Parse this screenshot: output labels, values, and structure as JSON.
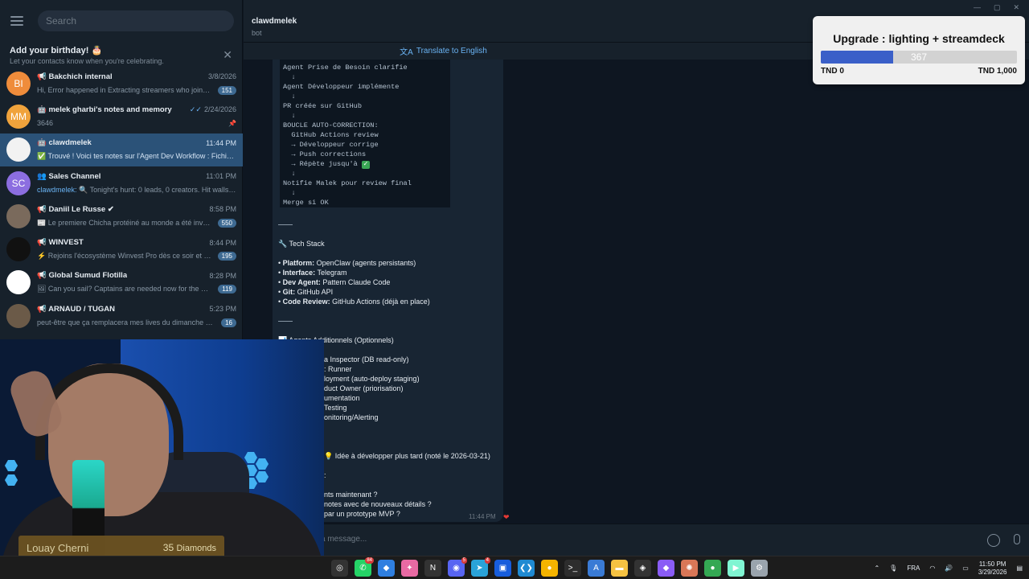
{
  "sidebar": {
    "search_placeholder": "Search",
    "birthday_title": "Add your birthday! 🎂",
    "birthday_sub": "Let your contacts know when you're celebrating.",
    "chats": [
      {
        "initials": "BI",
        "color": "#ef8c3b",
        "name": "📢 Bakchich internal",
        "time": "3/8/2026",
        "preview": "Hi, Error happened in Extracting streamers who joined ...",
        "badge": "151"
      },
      {
        "initials": "MM",
        "color": "#f0a33c",
        "name": "🤖 melek gharbi's notes and memory",
        "time": "2/24/2026",
        "ticks": "✓✓",
        "preview": "3646",
        "pin": "📌"
      },
      {
        "initials": "",
        "color": "#f2f2f2",
        "name": "🤖 clawdmelek",
        "time": "11:44 PM",
        "preview": "✅ Trouvé ! Voici tes notes sur l'Agent Dev Workflow : Fichier...",
        "active": true
      },
      {
        "initials": "SC",
        "color": "#8c6ee0",
        "name": "👥 Sales Channel",
        "time": "11:01 PM",
        "sender": "clawdmelek:",
        "preview": " 🔍 Tonight's hunt: 0 leads, 0 creators. Hit walls ..."
      },
      {
        "initials": "",
        "color": "#7a6a5c",
        "name": "📢 Daniil Le Russe ✔",
        "time": "8:58 PM",
        "preview": "📰 Le premiere Chicha protéiné au monde a été invent...",
        "badge": "550"
      },
      {
        "initials": "",
        "color": "#111111",
        "name": "📢 WINVEST",
        "time": "8:44 PM",
        "preview": "⚡ Rejoins l'écosystème Winvest Pro dès ce soir et sois...",
        "badge": "195"
      },
      {
        "initials": "",
        "color": "#ffffff",
        "name": "📢 Global Sumud Flotilla",
        "time": "8:28 PM",
        "preview": "🖼 Can you sail?  Captains are needed now for the Glo...",
        "badge": "119"
      },
      {
        "initials": "",
        "color": "#6b5a48",
        "name": "📢 ARNAUD / TUGAN",
        "time": "5:23 PM",
        "preview": "peut-être que ça remplacera mes lives du dimanche que ...",
        "badge": "16"
      }
    ]
  },
  "header": {
    "title": "clawdmelek",
    "subtitle": "bot",
    "translate": "Translate to English"
  },
  "message": {
    "code_lines": [
      "Agent Prise de Besoin clarifie",
      "  ↓",
      "Agent Développeur implémente",
      "  ↓",
      "PR créée sur GitHub",
      "  ↓",
      "BOUCLE AUTO-CORRECTION:",
      "  GitHub Actions review",
      "  → Développeur corrige",
      "  → Push corrections",
      "  → Répète jusqu'à ",
      "  ↓",
      "Notifie Malek pour review final",
      "  ↓",
      "Merge si OK"
    ],
    "tech_stack_title": "🔧 Tech Stack",
    "tech_stack": [
      {
        "label": "Platform:",
        "value": " OpenClaw (agents persistants)"
      },
      {
        "label": "Interface:",
        "value": " Telegram"
      },
      {
        "label": "Dev Agent:",
        "value": " Pattern Claude Code"
      },
      {
        "label": "Git:",
        "value": " GitHub API"
      },
      {
        "label": "Code Review:",
        "value": " GitHub Actions (déjà en place)"
      }
    ],
    "optional_title": "📊 Agents Additionnels (Optionnels)",
    "optional_items": [
      "a Inspector (DB read-only)",
      ": Runner",
      "loyment (auto-deploy staging)",
      "duct Owner (priorisation)",
      "umentation",
      "Testing",
      "onitoring/Alerting"
    ],
    "idea_line": "💡 Idée à développer plus tard (noté le 2026-03-21)",
    "partial_colon": ":",
    "question_lines": [
      "nts maintenant ?",
      "notes avec de nouveaux détails ?",
      "par un prototype MVP ?"
    ],
    "time": "11:44 PM",
    "reaction": "❤"
  },
  "composer": {
    "placeholder": "a message..."
  },
  "goal": {
    "title": "Upgrade : lighting + streamdeck",
    "value": "367",
    "min_label": "TND 0",
    "max_label": "TND 1,000",
    "progress": 0.367
  },
  "webcam": {
    "name": "Louay Cherni",
    "diamonds": "35",
    "diamonds_label": "Diamonds"
  },
  "taskbar": {
    "icons": [
      {
        "name": "chatgpt-icon",
        "glyph": "◎",
        "color": "#ffffff"
      },
      {
        "name": "whatsapp-icon",
        "glyph": "✆",
        "color": "#25d366",
        "badge": "84"
      },
      {
        "name": "copilot-icon",
        "glyph": "◆",
        "color": "#2f7fe0"
      },
      {
        "name": "app-star-icon",
        "glyph": "✦",
        "color": "#e86aa3"
      },
      {
        "name": "notion-icon",
        "glyph": "N",
        "color": "#ffffff"
      },
      {
        "name": "discord-icon",
        "glyph": "◉",
        "color": "#5865f2",
        "badge": "5"
      },
      {
        "name": "telegram-icon",
        "glyph": "➤",
        "color": "#2aa3d9",
        "badge": "4"
      },
      {
        "name": "bitwarden-icon",
        "glyph": "▣",
        "color": "#175ddc"
      },
      {
        "name": "vscode-icon",
        "glyph": "❮❯",
        "color": "#1f8ad2"
      },
      {
        "name": "chrome-icon",
        "glyph": "●",
        "color": "#f5b400"
      },
      {
        "name": "terminal-icon",
        "glyph": ">_",
        "color": "#2d2d2d"
      },
      {
        "name": "app-a-icon",
        "glyph": "A",
        "color": "#3a7bd5"
      },
      {
        "name": "folder-icon",
        "glyph": "▬",
        "color": "#f5c242"
      },
      {
        "name": "unity-icon",
        "glyph": "◈",
        "color": "#e0e0e0"
      },
      {
        "name": "obsidian-icon",
        "glyph": "◆",
        "color": "#8a5cf6"
      },
      {
        "name": "claude-icon",
        "glyph": "✺",
        "color": "#d97757"
      },
      {
        "name": "chrome-2-icon",
        "glyph": "●",
        "color": "#34a853"
      },
      {
        "name": "streamlabs-icon",
        "glyph": "▶",
        "color": "#80f5d2"
      },
      {
        "name": "settings-icon",
        "glyph": "⚙",
        "color": "#9aa4ad"
      }
    ],
    "lang": "FRA",
    "time": "11:50 PM",
    "date": "3/29/2026"
  }
}
